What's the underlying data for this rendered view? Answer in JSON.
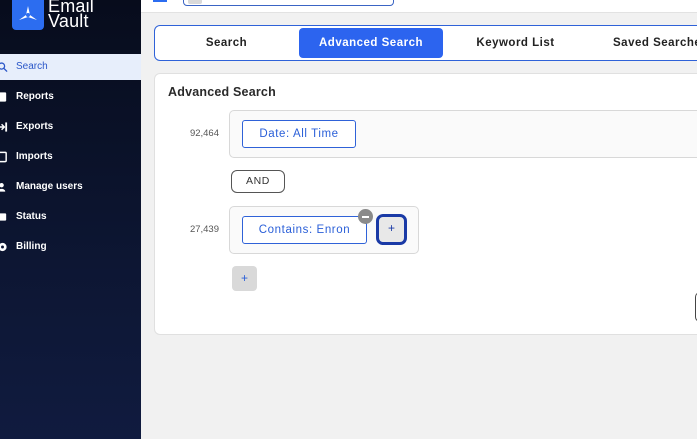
{
  "brand": {
    "line1": "Email",
    "line2": "Vault",
    "color": "#2c6df0"
  },
  "sidebar": {
    "items": [
      {
        "label": "Search",
        "icon": "search-icon",
        "active": true
      },
      {
        "label": "Reports",
        "icon": "report-icon"
      },
      {
        "label": "Exports",
        "icon": "export-icon"
      },
      {
        "label": "Imports",
        "icon": "import-icon"
      },
      {
        "label": "Manage users",
        "icon": "users-icon"
      },
      {
        "label": "Status",
        "icon": "status-icon"
      },
      {
        "label": "Billing",
        "icon": "billing-icon"
      }
    ]
  },
  "tabs": [
    {
      "label": "Search"
    },
    {
      "label": "Advanced Search",
      "active": true
    },
    {
      "label": "Keyword List"
    },
    {
      "label": "Saved Searches"
    }
  ],
  "card": {
    "title": "Advanced Search",
    "groups": [
      {
        "count": "92,464",
        "filter": "Date: All Time"
      },
      {
        "count": "27,439",
        "filter": "Contains: Enron"
      }
    ],
    "operator": "AND",
    "add_symbol": "+"
  }
}
